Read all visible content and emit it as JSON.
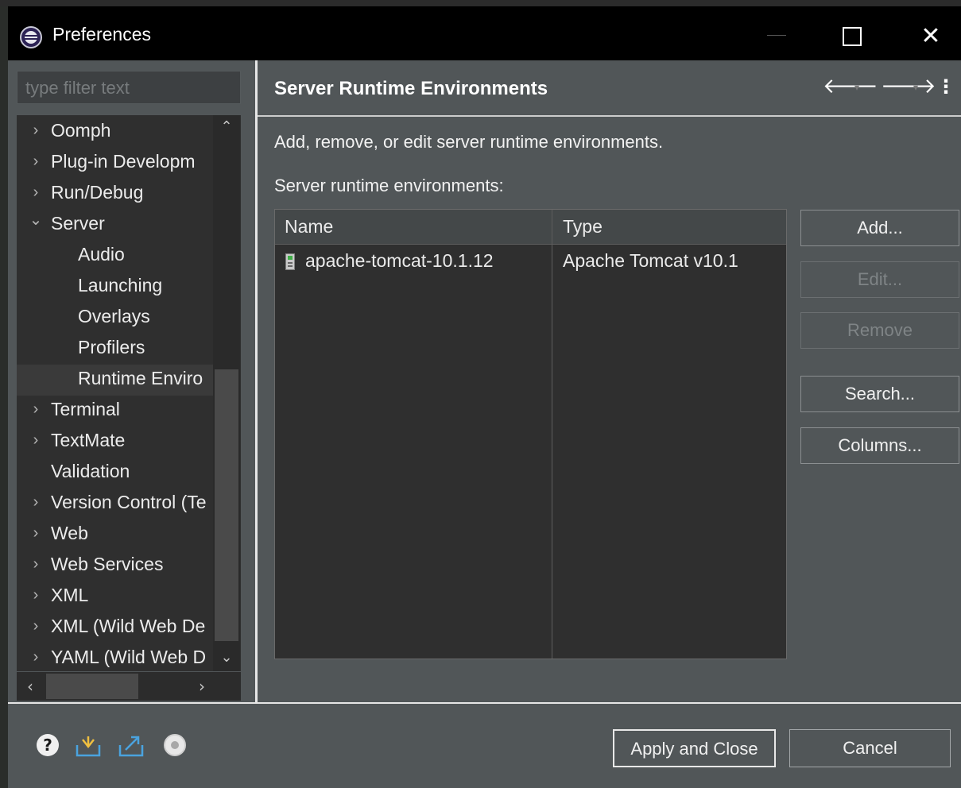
{
  "window": {
    "title": "Preferences",
    "controls": {
      "minimize": "—",
      "maximize": "",
      "close": "✕"
    }
  },
  "sidebar": {
    "filter_placeholder": "type filter text",
    "items": [
      {
        "label": "Oomph",
        "expander": "›",
        "level": 0
      },
      {
        "label": "Plug-in Developm",
        "expander": "›",
        "level": 0
      },
      {
        "label": "Run/Debug",
        "expander": "›",
        "level": 0
      },
      {
        "label": "Server",
        "expander": "⌄",
        "level": 0
      },
      {
        "label": "Audio",
        "expander": "",
        "level": 1
      },
      {
        "label": "Launching",
        "expander": "",
        "level": 1
      },
      {
        "label": "Overlays",
        "expander": "",
        "level": 1
      },
      {
        "label": "Profilers",
        "expander": "",
        "level": 1
      },
      {
        "label": "Runtime Enviro",
        "expander": "",
        "level": 1,
        "selected": true
      },
      {
        "label": "Terminal",
        "expander": "›",
        "level": 0
      },
      {
        "label": "TextMate",
        "expander": "›",
        "level": 0
      },
      {
        "label": "Validation",
        "expander": "",
        "level": 0
      },
      {
        "label": "Version Control (Te",
        "expander": "›",
        "level": 0
      },
      {
        "label": "Web",
        "expander": "›",
        "level": 0
      },
      {
        "label": "Web Services",
        "expander": "›",
        "level": 0
      },
      {
        "label": "XML",
        "expander": "›",
        "level": 0
      },
      {
        "label": "XML (Wild Web De",
        "expander": "›",
        "level": 0
      },
      {
        "label": "YAML (Wild Web D",
        "expander": "›",
        "level": 0
      }
    ],
    "scroll": {
      "up": "⌃",
      "down": "⌄",
      "left": "‹",
      "right": "›"
    }
  },
  "page": {
    "title": "Server Runtime Environments",
    "nav": {
      "back": "🡐",
      "forward": "🡒",
      "dropdown": "▾",
      "menu": "⋮"
    },
    "description": "Add, remove, or edit server runtime environments.",
    "table_label": "Server runtime environments:",
    "table": {
      "columns": [
        "Name",
        "Type"
      ],
      "rows": [
        {
          "name": "apache-tomcat-10.1.12",
          "type": "Apache Tomcat v10.1"
        }
      ]
    },
    "buttons": {
      "add": "Add...",
      "edit": "Edit...",
      "remove": "Remove",
      "search": "Search...",
      "columns": "Columns..."
    }
  },
  "footer": {
    "help_glyph": "?",
    "apply_and_close": "Apply and Close",
    "cancel": "Cancel"
  },
  "colors": {
    "panel": "#515658",
    "titlebar": "#000000",
    "tree_bg": "#2f2f2f",
    "table_bg": "#2f2f2f",
    "text": "#eaeaea",
    "disabled_text": "#7f8486"
  }
}
